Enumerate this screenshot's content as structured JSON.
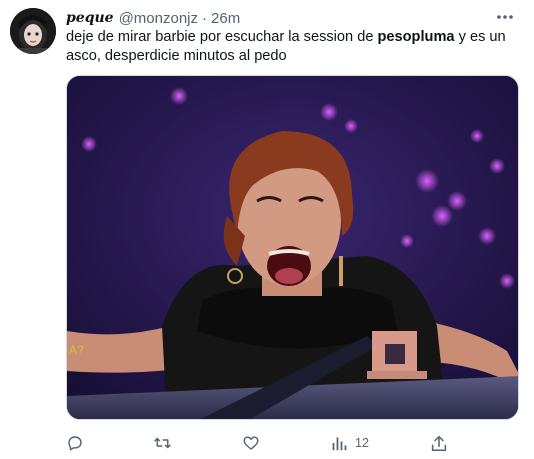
{
  "tweet": {
    "display_name": "peque",
    "handle": "@monzonjz",
    "separator": "·",
    "time": "26m",
    "text_before": "deje de mirar barbie por escuchar la session de ",
    "text_bold": "pesopluma",
    "text_after": " y es un asco, desperdicie minutos al pedo"
  },
  "icons": {
    "more": "more-horizontal-icon",
    "reply": "reply-icon",
    "retweet": "retweet-icon",
    "like": "heart-icon",
    "views": "analytics-icon",
    "share": "share-icon"
  },
  "actions": {
    "views_count": "12"
  },
  "colors": {
    "secondary_text": "#536471",
    "primary_text": "#0f1419",
    "border": "#cfd9de"
  }
}
